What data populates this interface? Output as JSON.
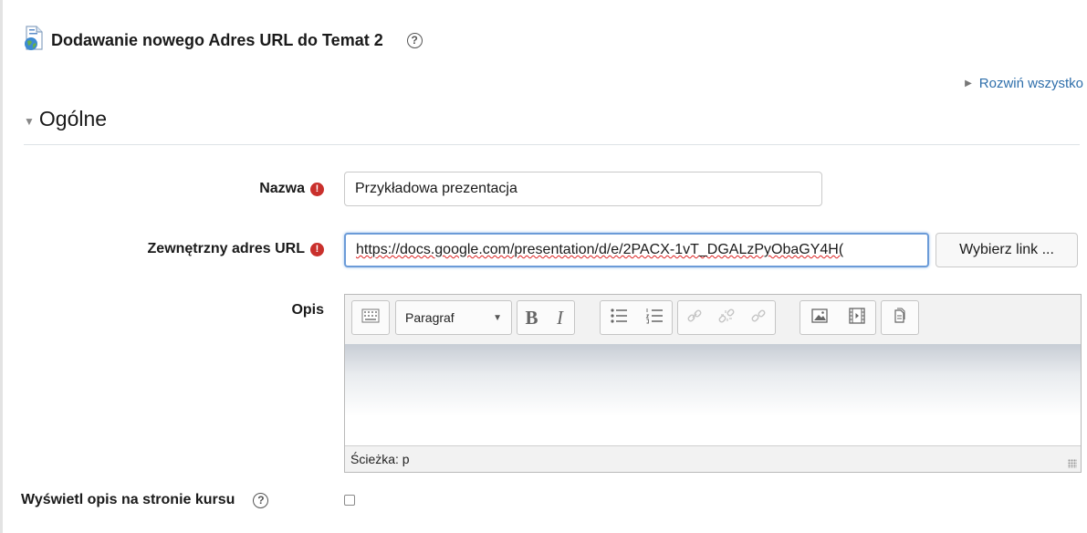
{
  "header": {
    "title": "Dodawanie nowego Adres URL do Temat 2",
    "help_glyph": "?"
  },
  "expand_all_label": "Rozwiń wszystko",
  "section": {
    "title": "Ogólne"
  },
  "form": {
    "name": {
      "label": "Nazwa",
      "value": "Przykładowa prezentacja",
      "required_glyph": "!"
    },
    "url": {
      "label": "Zewnętrzny adres URL",
      "value": "https://docs.google.com/presentation/d/e/2PACX-1vT_DGALzPyObaGY4H(",
      "required_glyph": "!",
      "choose_button": "Wybierz link ..."
    },
    "description": {
      "label": "Opis",
      "paragraph_select": "Paragraf",
      "path_label": "Ścieżka: p"
    },
    "show_description": {
      "label": "Wyświetl opis na stronie kursu",
      "checked": false
    }
  },
  "colors": {
    "link": "#2f6fab",
    "required": "#c9302c",
    "focus_border": "#6b9bd8"
  }
}
